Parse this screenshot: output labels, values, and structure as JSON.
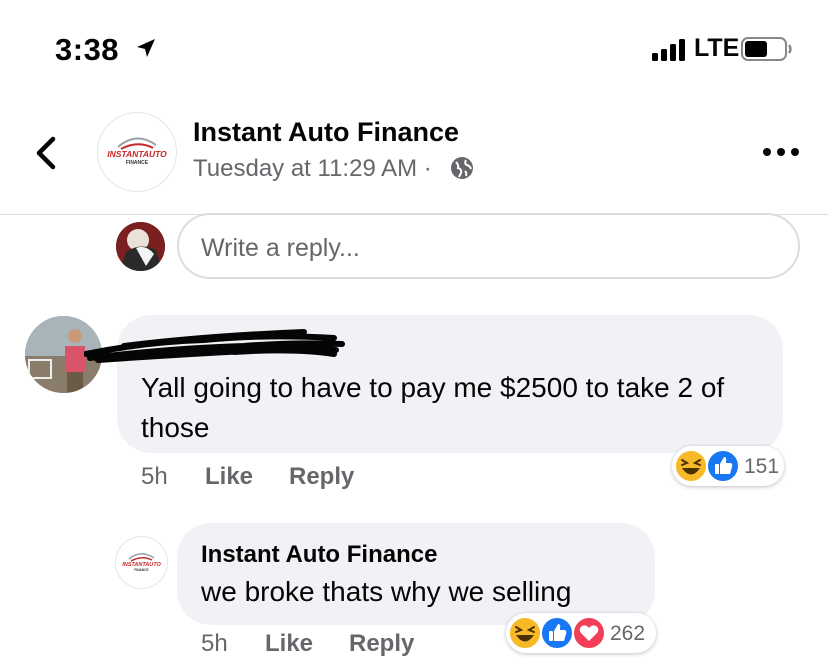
{
  "status_bar": {
    "time": "3:38",
    "carrier": "LTE"
  },
  "header": {
    "page_name": "Instant Auto Finance",
    "timestamp": "Tuesday at 11:29 AM ·",
    "logo_text_top": "INSTANTAUTO",
    "logo_text_bottom": "FINANCE"
  },
  "reply_box": {
    "placeholder": "Write a reply..."
  },
  "comments": [
    {
      "author": "[redacted]",
      "text": "Yall going to have to pay me $2500 to take 2 of those",
      "age": "5h",
      "like_label": "Like",
      "reply_label": "Reply",
      "reaction_count": "151",
      "reactions": [
        "haha",
        "like"
      ]
    },
    {
      "author": "Instant Auto Finance",
      "text": "we broke thats why we selling",
      "age": "5h",
      "like_label": "Like",
      "reply_label": "Reply",
      "reaction_count": "262",
      "reactions": [
        "haha",
        "like",
        "love"
      ]
    }
  ],
  "colors": {
    "bubble": "#f0f2f5",
    "secondary_text": "#65676b",
    "like_blue": "#1877f2",
    "love_red": "#f33e58",
    "haha_yellow": "#f7b928"
  }
}
